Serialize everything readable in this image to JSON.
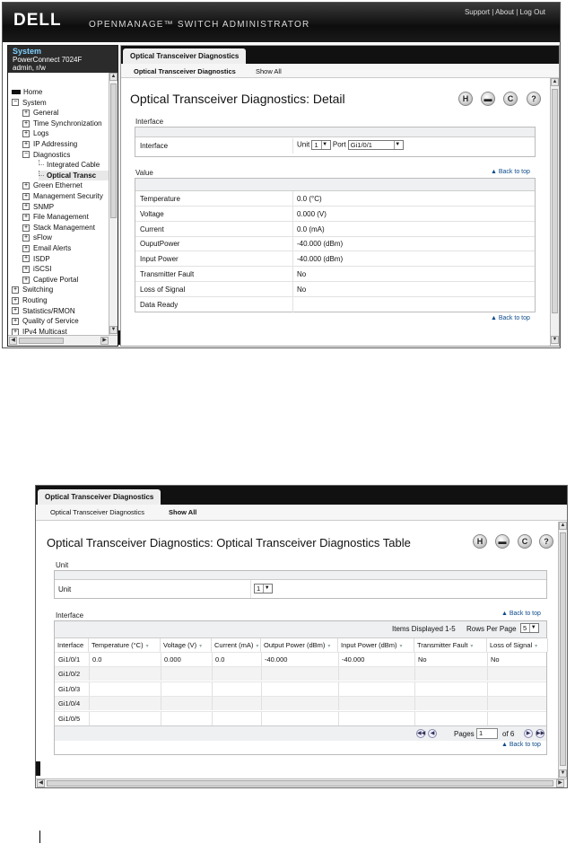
{
  "screen1": {
    "header": {
      "logo": "DELL",
      "brand": "OPENMANAGE™ SWITCH ADMINISTRATOR",
      "links": [
        "Support",
        "About",
        "Log Out"
      ],
      "separator": " | "
    },
    "system": {
      "title": "System",
      "model": "PowerConnect 7024F",
      "user": "admin, r/w"
    },
    "tree": [
      {
        "label": "Home",
        "marker": "line"
      },
      {
        "label": "System",
        "marker": "minus"
      },
      {
        "label": "General",
        "marker": "plus"
      },
      {
        "label": "Time Synchronization",
        "marker": "plus"
      },
      {
        "label": "Logs",
        "marker": "plus"
      },
      {
        "label": "IP Addressing",
        "marker": "plus"
      },
      {
        "label": "Diagnostics",
        "marker": "minus"
      },
      {
        "label": "Integrated Cable",
        "marker": "none"
      },
      {
        "label": "Optical Transc",
        "marker": "none",
        "selected": true
      },
      {
        "label": "Green Ethernet",
        "marker": "plus"
      },
      {
        "label": "Management Security",
        "marker": "plus"
      },
      {
        "label": "SNMP",
        "marker": "plus"
      },
      {
        "label": "File Management",
        "marker": "plus"
      },
      {
        "label": "Stack Management",
        "marker": "plus"
      },
      {
        "label": "sFlow",
        "marker": "plus"
      },
      {
        "label": "Email Alerts",
        "marker": "plus"
      },
      {
        "label": "ISDP",
        "marker": "plus"
      },
      {
        "label": "iSCSI",
        "marker": "plus"
      },
      {
        "label": "Captive Portal",
        "marker": "plus"
      },
      {
        "label": "Switching",
        "marker": "plus"
      },
      {
        "label": "Routing",
        "marker": "plus"
      },
      {
        "label": "Statistics/RMON",
        "marker": "plus"
      },
      {
        "label": "Quality of Service",
        "marker": "plus"
      },
      {
        "label": "IPv4 Multicast",
        "marker": "plus"
      }
    ],
    "main": {
      "tab": "Optical Transceiver Diagnostics",
      "subtabs": [
        "Optical Transceiver Diagnostics",
        "Show All"
      ],
      "title": "Optical Transceiver Diagnostics: Detail",
      "icons": [
        "save-icon",
        "print-icon",
        "refresh-icon",
        "help-icon"
      ],
      "icon_glyphs": [
        "H",
        "▬",
        "C",
        "?"
      ],
      "interface_section": "Interface",
      "interface_row": {
        "label": "Interface",
        "unit_label": "Unit",
        "unit_value": "1",
        "port_label": "Port",
        "port_value": "Gi1/0/1"
      },
      "value_section": "Value",
      "back_to_top": "▲ Back to top",
      "values": [
        {
          "label": "Temperature",
          "value": "0.0  (°C)"
        },
        {
          "label": "Voltage",
          "value": "0.000  (V)"
        },
        {
          "label": "Current",
          "value": "0.0  (mA)"
        },
        {
          "label": "OuputPower",
          "value": "-40.000  (dBm)"
        },
        {
          "label": "Input Power",
          "value": "-40.000  (dBm)"
        },
        {
          "label": "Transmitter Fault",
          "value": "No"
        },
        {
          "label": "Loss of Signal",
          "value": "No"
        },
        {
          "label": "Data Ready",
          "value": ""
        }
      ]
    }
  },
  "screen2": {
    "tab": "Optical Transceiver Diagnostics",
    "subtabs": [
      "Optical Transceiver Diagnostics",
      "Show All"
    ],
    "title": "Optical Transceiver Diagnostics: Optical Transceiver Diagnostics Table",
    "icons": [
      "save-icon",
      "print-icon",
      "refresh-icon",
      "help-icon"
    ],
    "icon_glyphs": [
      "H",
      "▬",
      "C",
      "?"
    ],
    "unit_section": "Unit",
    "unit_row": {
      "label": "Unit",
      "value": "1"
    },
    "interface_section": "Interface",
    "back_to_top": "▲ Back to top",
    "items_displayed": "Items Displayed 1-5",
    "rows_per_page_label": "Rows Per Page",
    "rows_per_page_value": "5",
    "columns": [
      "Interface",
      "Temperature (°C)",
      "Voltage (V)",
      "Current (mA)",
      "Output Power (dBm)",
      "Input Power (dBm)",
      "Transmitter Fault",
      "Loss of Signal"
    ],
    "rows": [
      [
        "Gi1/0/1",
        "0.0",
        "0.000",
        "0.0",
        "-40.000",
        "-40.000",
        "No",
        "No"
      ],
      [
        "Gi1/0/2",
        "",
        "",
        "",
        "",
        "",
        "",
        ""
      ],
      [
        "Gi1/0/3",
        "",
        "",
        "",
        "",
        "",
        "",
        ""
      ],
      [
        "Gi1/0/4",
        "",
        "",
        "",
        "",
        "",
        "",
        ""
      ],
      [
        "Gi1/0/5",
        "",
        "",
        "",
        "",
        "",
        "",
        ""
      ]
    ],
    "pagination": {
      "label": "Pages",
      "current": "1",
      "of_label": "of 6"
    }
  }
}
